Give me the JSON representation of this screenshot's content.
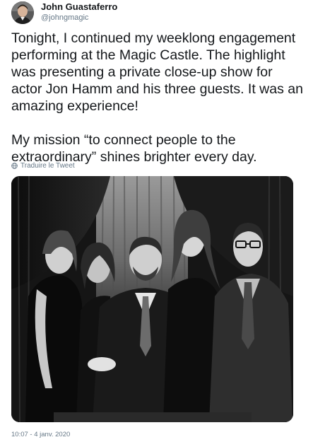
{
  "user": {
    "display_name": "John Guastaferro",
    "handle": "@johngmagic",
    "avatar_icon": "user-avatar"
  },
  "tweet": {
    "text": "Tonight, I continued my weeklong engagement performing at the Magic Castle. The highlight was presenting a private close-up show for actor Jon Hamm and his three guests. It was an amazing experience!\n\nMy mission “to connect people to the extraordinary” shines brighter every day.",
    "translate_label": "Traduire le Tweet",
    "timestamp": "10:07 - 4 janv. 2020"
  },
  "colors": {
    "text": "#14171a",
    "secondary": "#657786"
  }
}
